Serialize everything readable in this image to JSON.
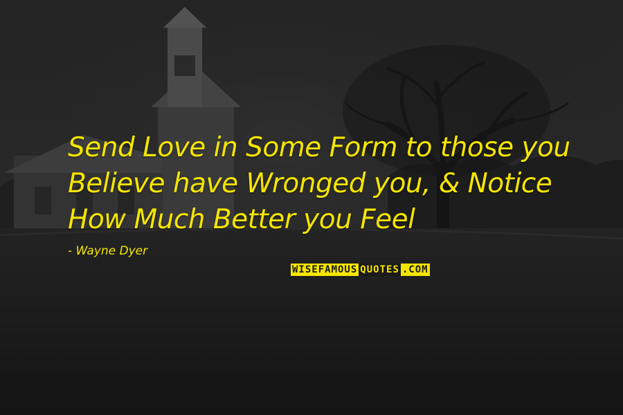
{
  "quote": {
    "lines": [
      "Send Love in Some Form to those you",
      "Believe have Wronged you, & Notice",
      "How Much Better you Feel"
    ],
    "author": "- Wayne Dyer",
    "color": "#f5e600"
  },
  "brand": {
    "part_a": "WISEFAMOUS",
    "part_b": "QUOTES",
    "part_c": ".COM",
    "color": "#f5e600"
  },
  "background": {
    "description_icon": "dark-rural-church-photo",
    "tint": "#1c1c1c"
  }
}
